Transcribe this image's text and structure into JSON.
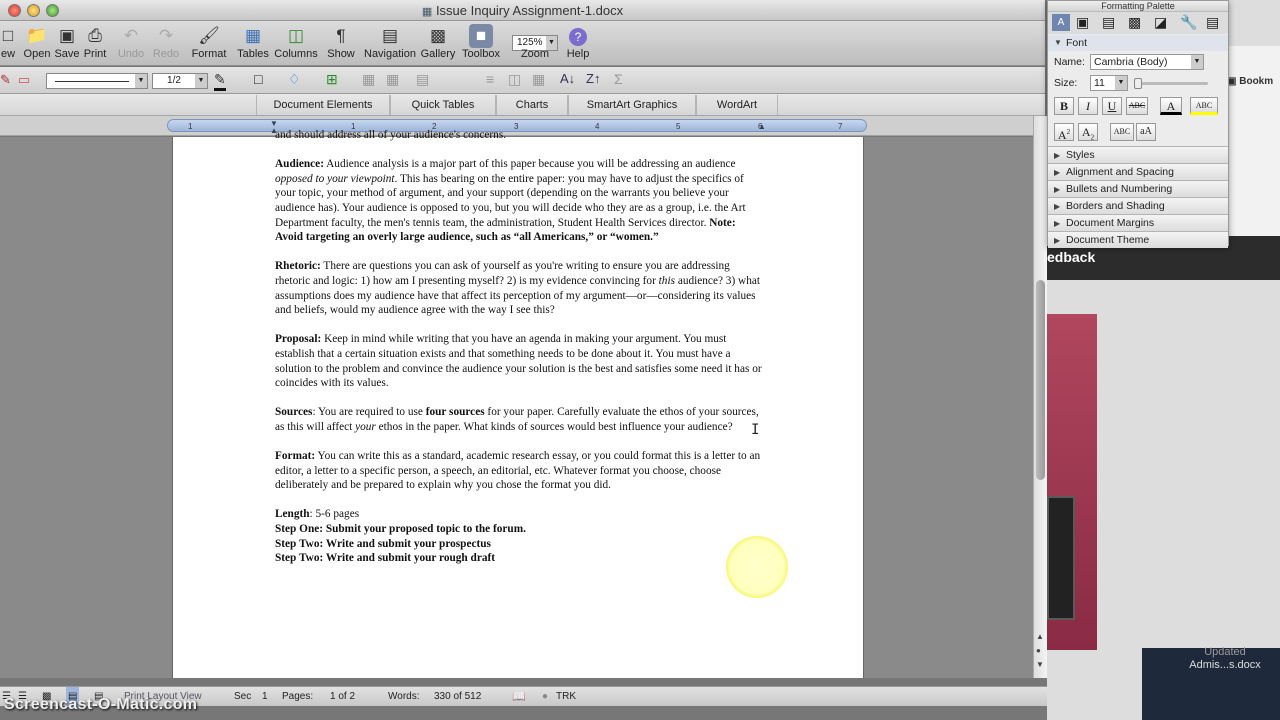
{
  "window": {
    "title": "Issue Inquiry Assignment-1.docx"
  },
  "toolbar": {
    "items": [
      "ew",
      "Open",
      "Save",
      "Print",
      "Undo",
      "Redo",
      "Format",
      "Tables",
      "Columns",
      "Show",
      "Navigation",
      "Gallery",
      "Toolbox",
      "Zoom",
      "Help"
    ],
    "zoom_value": "125%"
  },
  "formatting_bar": {
    "page_indicator": "1/2"
  },
  "ribbon": {
    "tabs": [
      "Document Elements",
      "Quick Tables",
      "Charts",
      "SmartArt Graphics",
      "WordArt"
    ]
  },
  "ruler": {
    "numbers": [
      "1",
      "1",
      "2",
      "3",
      "4",
      "5",
      "6",
      "7"
    ]
  },
  "document": {
    "top_fragment": "and should address all of your audience's concerns.",
    "paragraphs": [
      {
        "label": "Audience:",
        "parts": [
          {
            "t": " Audience analysis is a major part of this paper because you will be addressing an audience "
          },
          {
            "t": "opposed to your viewpoint",
            "i": true
          },
          {
            "t": ". This has bearing on the entire paper: you may have to adjust the specifics of your topic, your method of argument, and your support (depending on the warrants you believe your audience has). Your audience is opposed to you, but you will decide who they are as a group, i.e. the Art Department faculty, the men's tennis team, the administration, Student Health Services director.  "
          },
          {
            "t": "Note: Avoid targeting an overly large audience, such as “all Americans,” or “women.”",
            "b": true
          }
        ]
      },
      {
        "label": "Rhetoric:",
        "parts": [
          {
            "t": " There are questions you can ask of yourself as you're writing to ensure you are addressing rhetoric and logic: 1) how am I presenting myself? 2) is my evidence convincing for "
          },
          {
            "t": "this",
            "i": true
          },
          {
            "t": " audience? 3) what assumptions does my audience have that affect its perception of my argument—or—considering its values and beliefs, would my audience agree with the way I see this?"
          }
        ]
      },
      {
        "label": "Proposal:",
        "parts": [
          {
            "t": " Keep in mind while writing that you have an agenda in making your argument. You must establish that a certain situation exists and that something needs to be done about it. You must have a solution to the problem and convince the audience your solution is the best and satisfies some need it has or coincides with its values."
          }
        ]
      },
      {
        "label": "Sources",
        "parts": [
          {
            "t": ": You are required to use "
          },
          {
            "t": "four sources",
            "b": true
          },
          {
            "t": " for your paper. Carefully evaluate the ethos of your sources, as this will affect "
          },
          {
            "t": "your",
            "i": true
          },
          {
            "t": " ethos in the paper. What kinds of sources would best influence your audience?"
          }
        ]
      },
      {
        "label": "Format:",
        "parts": [
          {
            "t": " You can write this as a standard, academic research essay, or you could format this is a letter to an editor, a letter to a specific person, a speech, an editorial, etc.  Whatever format you choose, choose deliberately and be prepared to explain why you chose the format you did."
          }
        ]
      }
    ],
    "length_label": "Length",
    "length_value": ": 5-6 pages",
    "steps": [
      "Step One: Submit your proposed topic to the forum.",
      "Step Two: Write and submit your prospectus",
      "Step Two: Write and submit your rough draft"
    ]
  },
  "statusbar": {
    "view": "Print Layout View",
    "sec_label": "Sec",
    "sec_value": "1",
    "pages_label": "Pages:",
    "pages_value": "1 of 2",
    "words_label": "Words:",
    "words_value": "330 of 512",
    "trk": "TRK"
  },
  "palette": {
    "title": "Formatting Palette",
    "font_section": "Font",
    "name_label": "Name:",
    "name_value": "Cambria (Body)",
    "size_label": "Size:",
    "size_value": "11",
    "sections": [
      "Styles",
      "Alignment and Spacing",
      "Bullets and Numbering",
      "Borders and Shading",
      "Document Margins",
      "Document Theme"
    ]
  },
  "background": {
    "bookmark": "Bookm",
    "feedback": "edback",
    "updated_line1": "Updated",
    "updated_line2": "Admis...s.docx"
  },
  "watermark": "Screencast-O-Matic.com"
}
